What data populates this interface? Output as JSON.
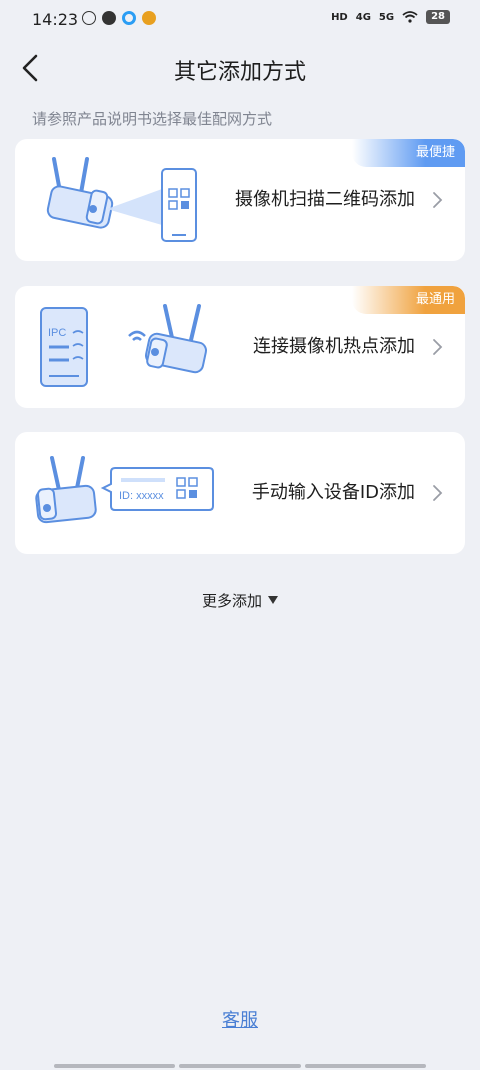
{
  "status_bar": {
    "time": "14:23",
    "network_labels": [
      "HD",
      "4G",
      "5G"
    ],
    "battery": "28"
  },
  "header": {
    "title": "其它添加方式"
  },
  "hint": "请参照产品说明书选择最佳配网方式",
  "options": [
    {
      "label": "摄像机扫描二维码添加",
      "badge": "最便捷",
      "badge_color": "#5f9bf2"
    },
    {
      "label": "连接摄像机热点添加",
      "badge": "最通用",
      "badge_color": "#f0a23e"
    },
    {
      "label": "手动输入设备ID添加",
      "badge": ""
    }
  ],
  "illustrations": {
    "phone_label": "IPC",
    "id_label": "ID: xxxxx"
  },
  "more_add": "更多添加",
  "support": "客服",
  "colors": {
    "background": "#eef0f5",
    "accent_blue": "#4a7fd4",
    "illustration_blue": "#5b8fe0",
    "illustration_fill": "#dbe7fb"
  }
}
